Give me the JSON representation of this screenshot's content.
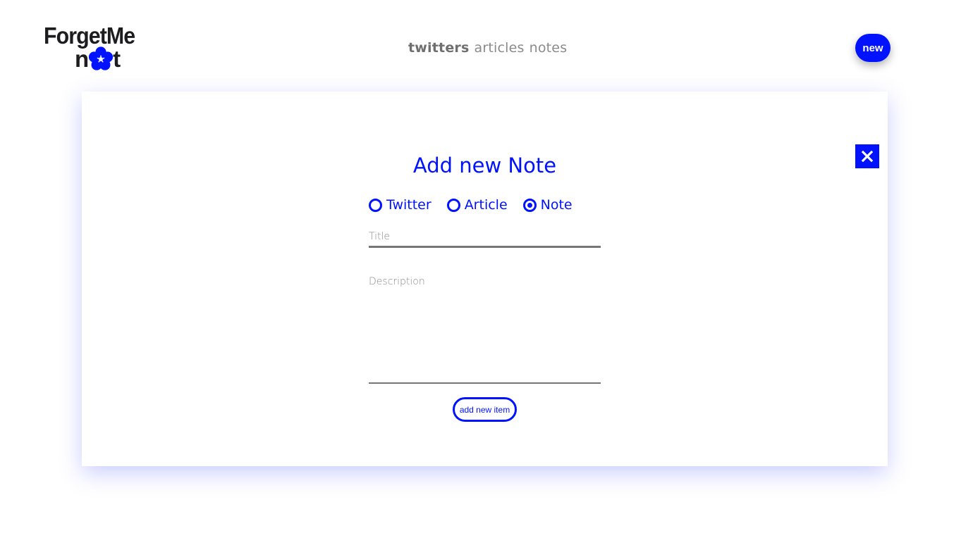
{
  "header": {
    "logo_text_top": "ForgetMe",
    "logo_text_bottom_left": "n",
    "logo_text_bottom_right": "t",
    "nav": [
      {
        "label": "twitters",
        "active": true
      },
      {
        "label": "articles",
        "active": false
      },
      {
        "label": "notes",
        "active": false
      }
    ],
    "new_button_label": "new"
  },
  "modal": {
    "title": "Add new Note",
    "close_icon": "close-icon",
    "radio_options": [
      {
        "label": "Twitter",
        "checked": false
      },
      {
        "label": "Article",
        "checked": false
      },
      {
        "label": "Note",
        "checked": true
      }
    ],
    "title_field": {
      "value": "",
      "placeholder": "Title"
    },
    "description_field": {
      "value": "",
      "placeholder": "Description"
    },
    "submit_label": "add new item"
  },
  "colors": {
    "accent": "#0012ff",
    "logo_text": "#1d1d1f",
    "nav_text": "#8a8a8a",
    "underline": "#767676"
  }
}
